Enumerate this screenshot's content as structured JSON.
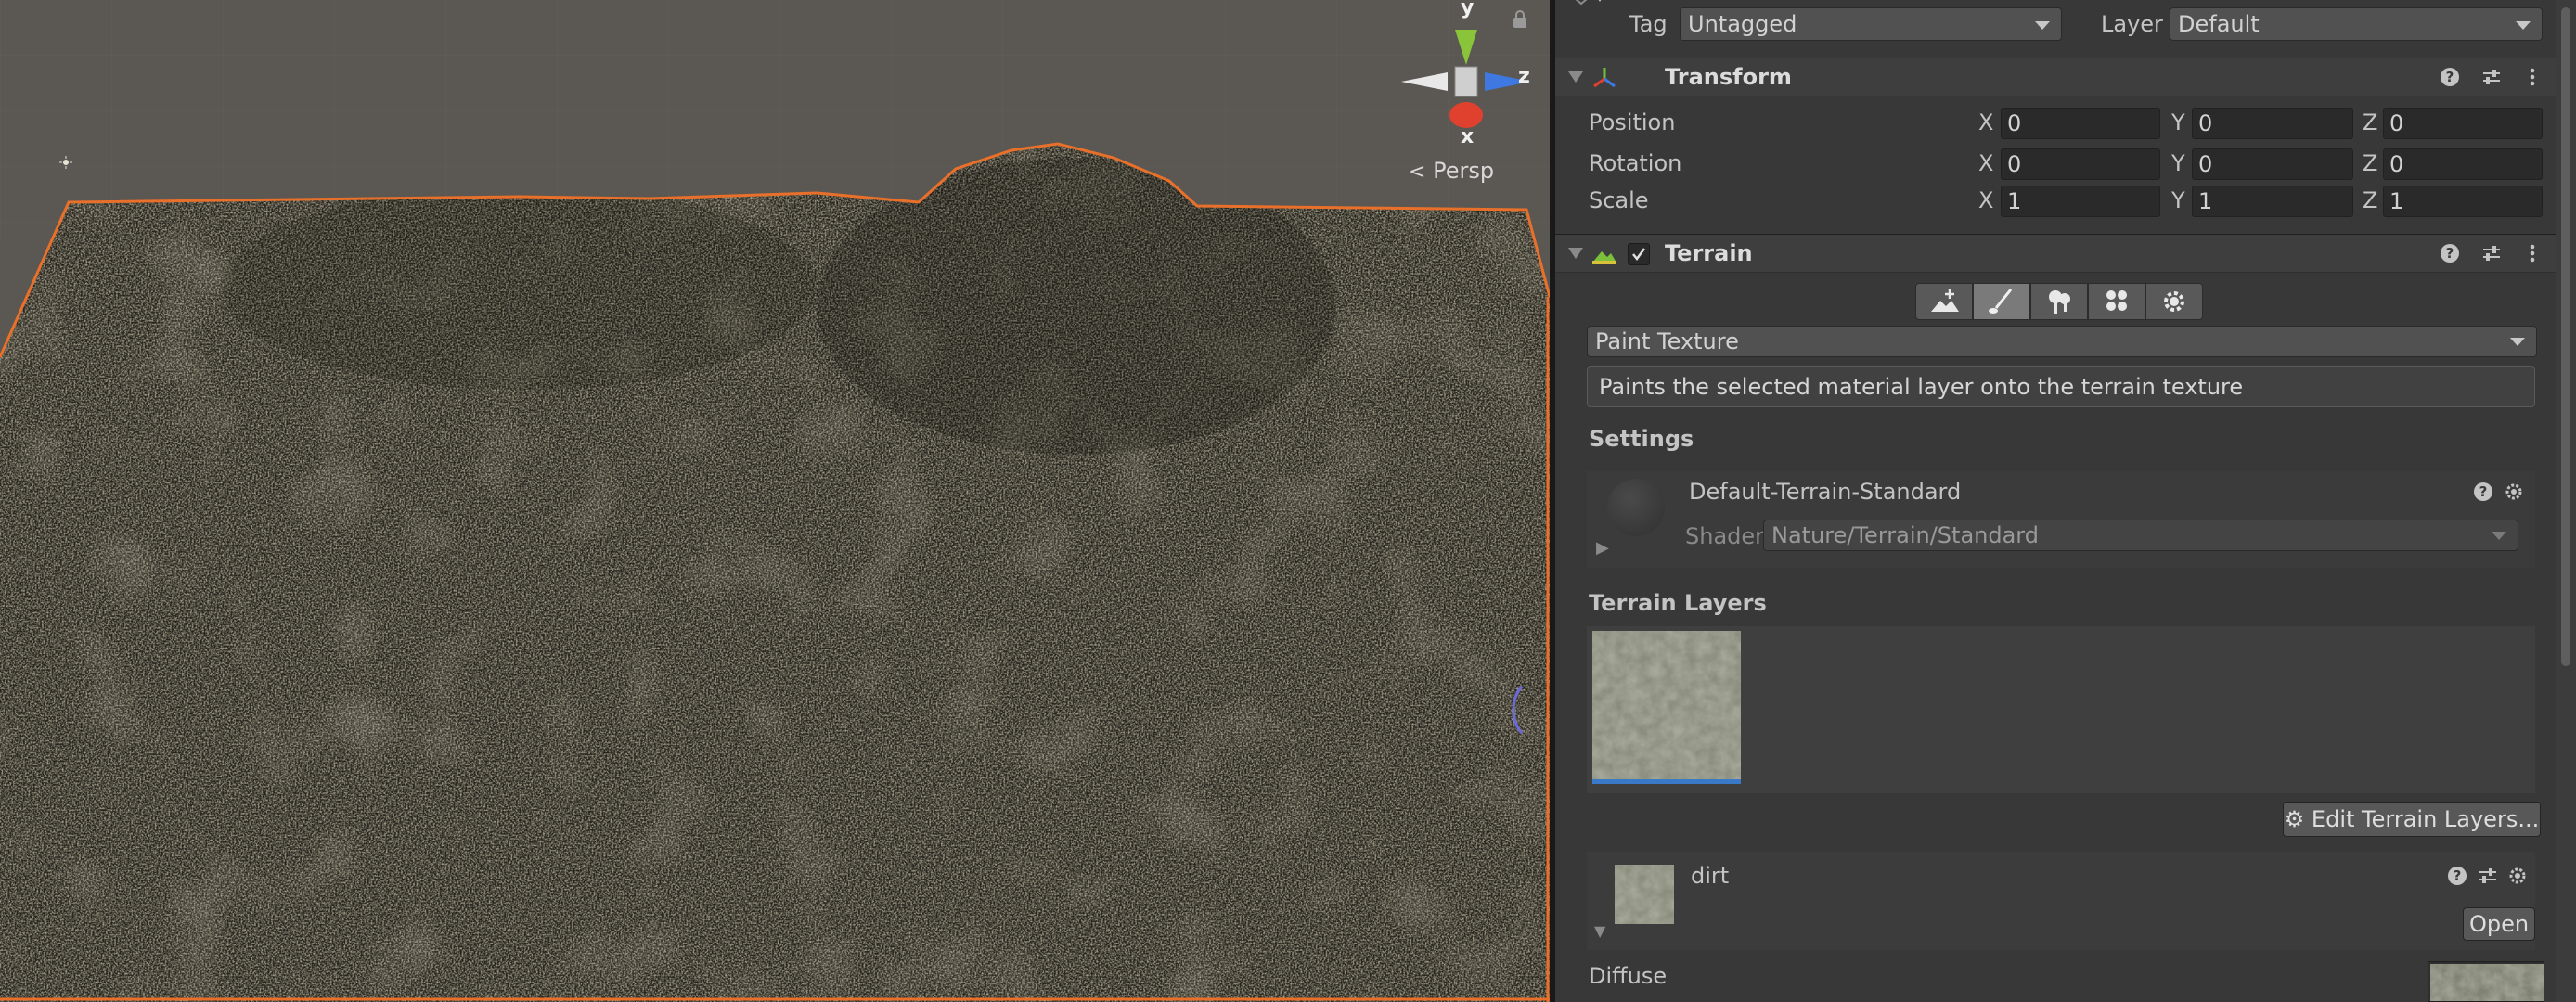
{
  "scene": {
    "persp_label": "Persp",
    "gizmo": {
      "x": "x",
      "y": "y",
      "z": "z"
    },
    "selection_color": "#e8702a"
  },
  "inspector": {
    "tag_label": "Tag",
    "tag_value": "Untagged",
    "layer_label": "Layer",
    "layer_value": "Default",
    "transform": {
      "title": "Transform",
      "position": {
        "label": "Position",
        "x": "0",
        "y": "0",
        "z": "0"
      },
      "rotation": {
        "label": "Rotation",
        "x": "0",
        "y": "0",
        "z": "0"
      },
      "scale": {
        "label": "Scale",
        "x": "1",
        "y": "1",
        "z": "1"
      },
      "axis_x": "X",
      "axis_y": "Y",
      "axis_z": "Z"
    },
    "terrain": {
      "title": "Terrain",
      "enabled": true,
      "tools": [
        "raise-lower-terrain-icon",
        "paint-brush-icon",
        "tree-icon",
        "flower-details-icon",
        "settings-gear-icon"
      ],
      "active_tool": "paint-brush-icon",
      "mode": "Paint Texture",
      "description": "Paints the selected material layer onto the terrain texture",
      "settings_label": "Settings",
      "material_name": "Default-Terrain-Standard",
      "shader_label": "Shader",
      "shader_value": "Nature/Terrain/Standard",
      "terrain_layers_label": "Terrain Layers",
      "edit_layers_label": "Edit Terrain Layers...",
      "layer_name": "dirt",
      "open_label": "Open",
      "diffuse_label": "Diffuse"
    }
  }
}
